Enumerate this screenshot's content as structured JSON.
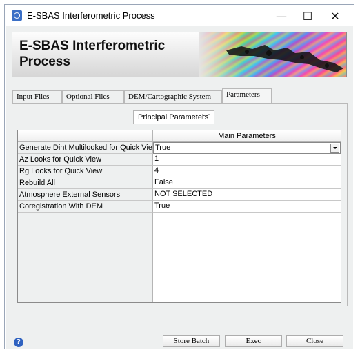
{
  "window": {
    "title": "E-SBAS Interferometric Process",
    "controls": {
      "minimize": "—",
      "maximize": "☐",
      "close": "✕"
    }
  },
  "banner": {
    "title_line1": "E-SBAS Interferometric",
    "title_line2": "Process"
  },
  "tabs": [
    {
      "label": "Input Files",
      "active": false
    },
    {
      "label": "Optional Files",
      "active": false
    },
    {
      "label": "DEM/Cartographic System",
      "active": false
    },
    {
      "label": "Parameters",
      "active": true
    }
  ],
  "parameters": {
    "dropdown": {
      "selected": "Principal Parameters"
    },
    "table": {
      "header": {
        "label_col": "",
        "value_col": "Main Parameters"
      },
      "rows": [
        {
          "label": "Generate Dint Multilooked for Quick View",
          "value": "True"
        },
        {
          "label": "Az Looks for Quick View",
          "value": "1"
        },
        {
          "label": "Rg Looks for Quick View",
          "value": "4"
        },
        {
          "label": "Rebuild All",
          "value": "False"
        },
        {
          "label": "Atmosphere External Sensors",
          "value": "NOT SELECTED"
        },
        {
          "label": "Coregistration With DEM",
          "value": "True"
        }
      ]
    }
  },
  "buttons": {
    "store_batch": "Store Batch",
    "exec": "Exec",
    "close": "Close"
  },
  "help": {
    "glyph": "?"
  }
}
